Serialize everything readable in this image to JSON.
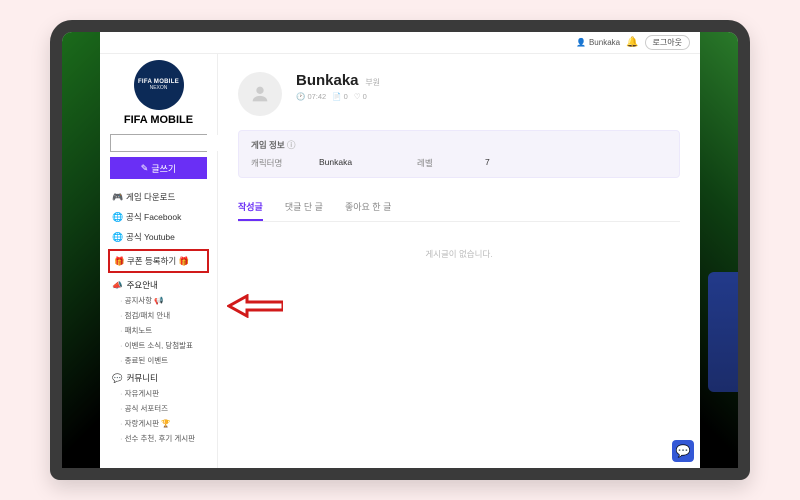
{
  "header": {
    "username": "Bunkaka",
    "login_label": "로그아웃"
  },
  "sidebar": {
    "logo_top": "FIFA",
    "logo_sub": "MOBILE",
    "logo_nexon": "NEXON",
    "title": "FIFA MOBILE",
    "search_placeholder": "",
    "write_label": "글쓰기",
    "items": {
      "download": "게임 다운로드",
      "facebook": "공식 Facebook",
      "youtube": "공식 Youtube",
      "coupon": "🎁 쿠폰 등록하기 🎁"
    },
    "sections": {
      "notice": {
        "title": "주요안내",
        "items": [
          "공지사항 📢",
          "점검/패치 안내",
          "패치노트",
          "이벤트 소식, 당첨발표",
          "종료된 이벤트"
        ]
      },
      "community": {
        "title": "커뮤니티",
        "items": [
          "자유게시판",
          "공식 서포터즈",
          "자랑게시판 🏆",
          "선수 추천, 후기 게시판"
        ]
      }
    }
  },
  "profile": {
    "name": "Bunkaka",
    "rank": "부원",
    "time": "07:42",
    "posts": "0",
    "likes": "0"
  },
  "game_info": {
    "title": "게임 정보",
    "char_label": "캐릭터명",
    "char_value": "Bunkaka",
    "level_label": "레벨",
    "level_value": "7"
  },
  "tabs": {
    "t1": "작성글",
    "t2": "댓글 단 글",
    "t3": "좋아요 한 글"
  },
  "empty_text": "게시글이 없습니다."
}
